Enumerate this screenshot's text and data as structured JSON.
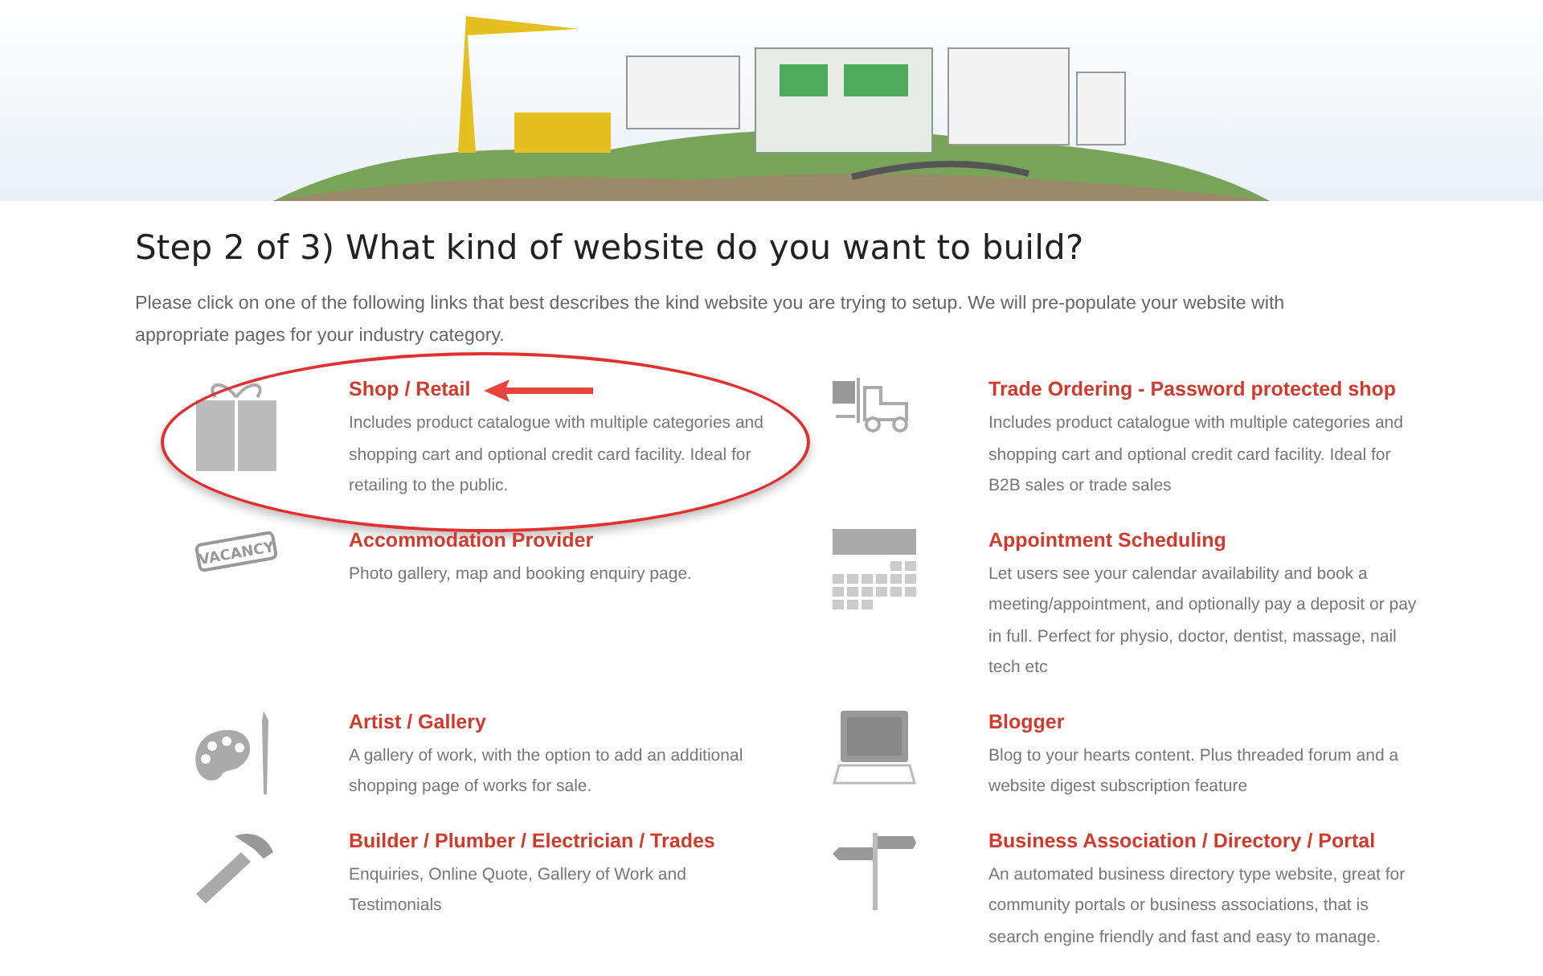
{
  "heading": "Step 2 of 3) What kind of website do you want to build?",
  "intro": "Please click on one of the following links that best describes the kind website you are trying to setup. We will pre-populate your website with appropriate pages for your industry category.",
  "items": [
    {
      "kind": "gift",
      "title": "Shop / Retail",
      "description": "Includes product catalogue with multiple categories and shopping cart and optional credit card facility. Ideal for retailing to the public.",
      "highlighted": true
    },
    {
      "kind": "forklift",
      "title": "Trade Ordering - Password protected shop",
      "description": "Includes product catalogue with multiple categories and shopping cart and optional credit card facility. Ideal for B2B sales or trade sales",
      "highlighted": false
    },
    {
      "kind": "stamp",
      "icon_text": "VACANCY",
      "title": "Accommodation Provider",
      "description": "Photo gallery, map and booking enquiry page.",
      "highlighted": false
    },
    {
      "kind": "calendar",
      "title": "Appointment Scheduling",
      "description": "Let users see your calendar availability and book a meeting/appointment, and optionally pay a deposit or pay in full. Perfect for physio, doctor, dentist, massage, nail tech etc",
      "highlighted": false
    },
    {
      "kind": "palette",
      "title": "Artist / Gallery",
      "description": "A gallery of work, with the option to add an additional shopping page of works for sale.",
      "highlighted": false
    },
    {
      "kind": "laptop",
      "title": "Blogger",
      "description": "Blog to your hearts content. Plus threaded forum and a website digest subscription feature",
      "highlighted": false
    },
    {
      "kind": "hammer",
      "title": "Builder / Plumber / Electrician / Trades",
      "description": "Enquiries, Online Quote, Gallery of Work and Testimonials",
      "highlighted": false
    },
    {
      "kind": "signpost",
      "title": "Business Association / Directory / Portal",
      "description": "An automated business directory type website, great for community portals or business associations, that is search engine friendly and fast and easy to manage.",
      "highlighted": false
    }
  ]
}
